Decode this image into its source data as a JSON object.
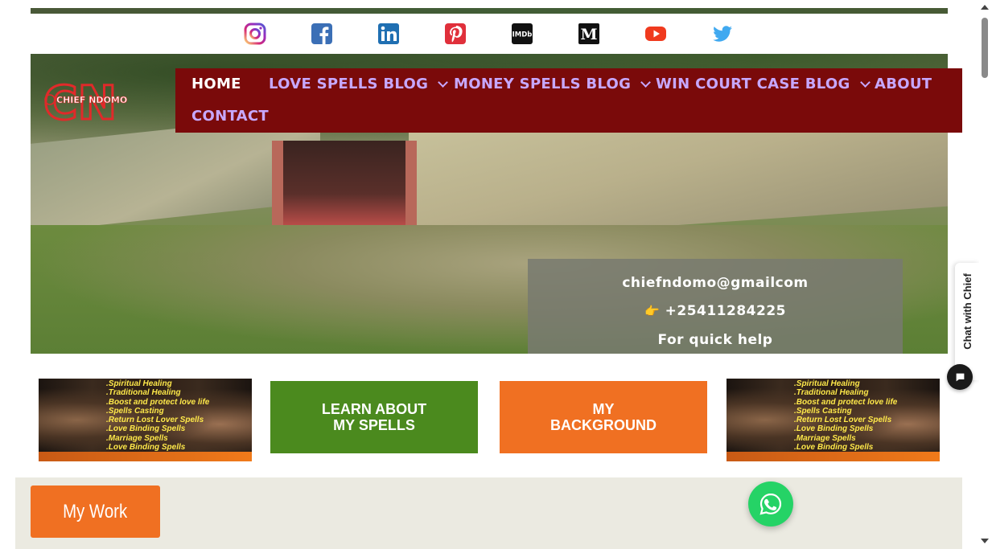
{
  "social": {
    "icons": [
      "instagram-icon",
      "facebook-icon",
      "linkedin-icon",
      "pinterest-icon",
      "imdb-icon",
      "medium-icon",
      "youtube-icon",
      "twitter-icon"
    ],
    "imdb_label": "IMDb",
    "medium_label": "M"
  },
  "logo": {
    "mark": "CN",
    "text": "CHIEF NDOMO"
  },
  "nav": {
    "items": [
      {
        "label": "HOME",
        "active": true,
        "has_dropdown": false
      },
      {
        "label": "LOVE SPELLS BLOG",
        "active": false,
        "has_dropdown": true
      },
      {
        "label": "MONEY SPELLS BLOG",
        "active": false,
        "has_dropdown": true
      },
      {
        "label": "WIN COURT CASE BLOG",
        "active": false,
        "has_dropdown": true
      },
      {
        "label": "ABOUT",
        "active": false,
        "has_dropdown": false
      },
      {
        "label": "CONTACT",
        "active": false,
        "has_dropdown": false
      }
    ]
  },
  "hero": {
    "email": "chiefndomo@gmailcom",
    "phone": "+25411284225",
    "phone_prefix": "👉",
    "help": "For quick help"
  },
  "banners": {
    "lines": [
      ".Spiritual Healing",
      ".Traditional Healing",
      ".Boost and protect love life",
      ".Spells Casting",
      ".Return Lost Lover Spells",
      ".Love Binding Spells",
      ".Marriage Spells",
      ".Love Binding Spells"
    ]
  },
  "cta": {
    "learn_line1": "LEARN ABOUT",
    "learn_line2": "MY SPELLS",
    "background_line1": "MY",
    "background_line2": "BACKGROUND"
  },
  "chat": {
    "label": "Chat with Chief"
  },
  "work": {
    "label": "My Work"
  },
  "colors": {
    "nav_bg": "#7a0a0a",
    "nav_text": "#c7a8ff",
    "nav_active": "#ffffff",
    "green_cta": "#4b8a1e",
    "orange_cta": "#f07022",
    "whatsapp": "#25d366",
    "section_bg": "#ebeae1"
  }
}
